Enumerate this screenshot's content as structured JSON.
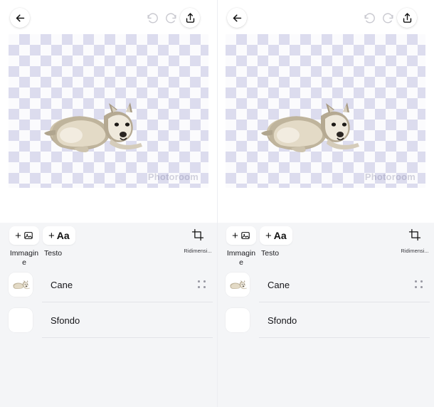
{
  "app": {
    "canvas_watermark": "Photoroom",
    "accent_dark": "#111111",
    "disabled_gray": "#c9c9d0",
    "sheet_bg": "#f4f5f7",
    "checker_light": "#fbfbfd",
    "checker_dark": "#dcdcee"
  },
  "toolbar": {
    "back_label": "Indietro",
    "undo_label": "Annulla",
    "redo_label": "Ripeti",
    "share_label": "Condividi",
    "icons": {
      "back": "arrow-left-icon",
      "undo": "undo-icon",
      "redo": "redo-icon",
      "share": "share-icon"
    }
  },
  "canvas": {
    "subject_name": "Cane",
    "background_type": "transparent-checkerboard"
  },
  "actions": [
    {
      "label": "Immagine",
      "chip_plus": "+",
      "chip_glyph": "image-icon",
      "name": "add-image-action"
    },
    {
      "label": "Testo",
      "chip_plus": "+",
      "chip_glyph": "Aa",
      "name": "add-text-action"
    },
    {
      "label": "Ridimensi...",
      "chip_plus": "",
      "chip_glyph": "crop-icon",
      "name": "resize-action"
    }
  ],
  "layers": [
    {
      "name": "Cane",
      "thumb": "dog-thumbnail",
      "has_handle": true
    },
    {
      "name": "Sfondo",
      "thumb": "empty-thumbnail",
      "has_handle": false
    }
  ],
  "panes": [
    {
      "id": "left"
    },
    {
      "id": "right"
    }
  ]
}
